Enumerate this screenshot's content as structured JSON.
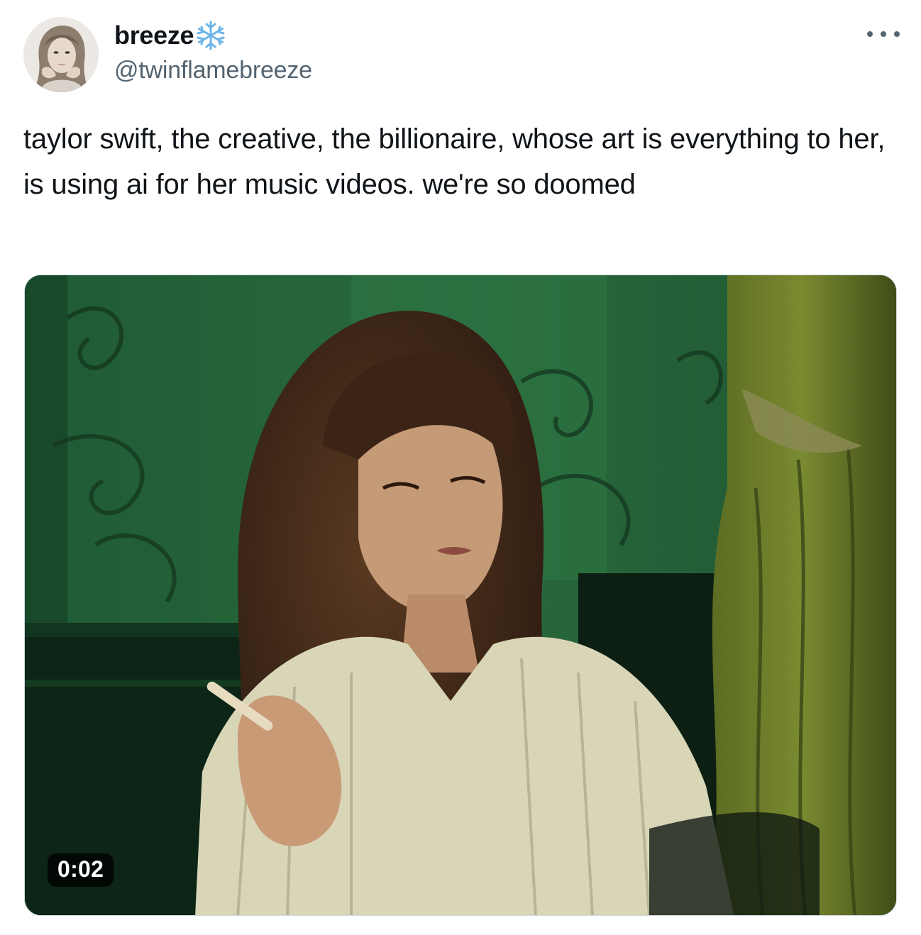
{
  "author": {
    "display_name": "breeze",
    "emoji": "snowflake-icon",
    "handle": "@twinflamebreeze",
    "avatar_icon": "profile-photo"
  },
  "tweet": {
    "text": "taylor swift, the creative, the billionaire, whose art is everything to her, is using ai for her music videos. we're so doomed"
  },
  "media": {
    "type": "video",
    "duration": "0:02"
  },
  "actions": {
    "more_icon": "more-horizontal-icon"
  },
  "colors": {
    "text_primary": "#0f1419",
    "text_secondary": "#536471",
    "snowflake": "#6cb4e8",
    "border": "#cfd9de"
  }
}
